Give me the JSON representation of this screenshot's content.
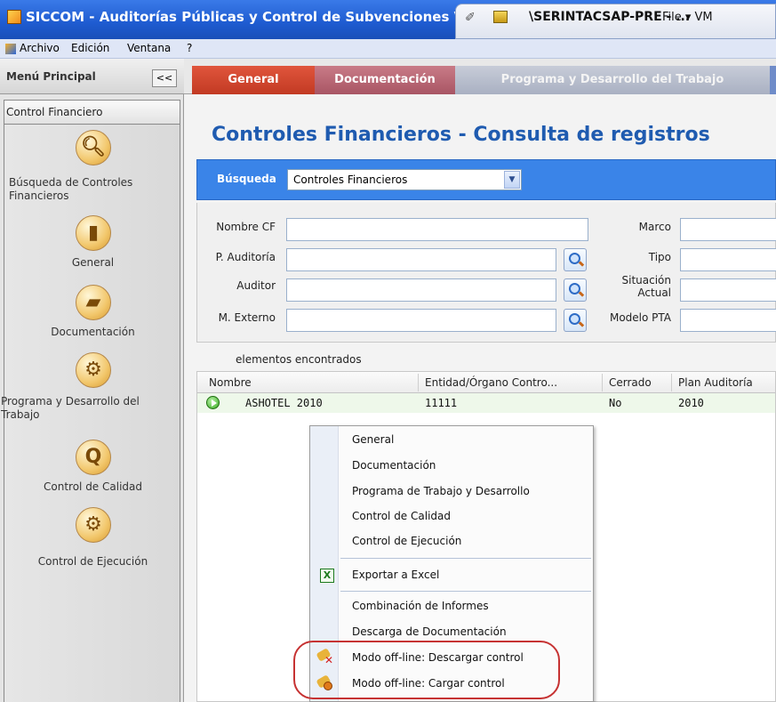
{
  "window": {
    "title": "SICCOM - Auditorías Públicas y Control de Subvenciones Ve",
    "remote_host": "\\SERINTACSAP-PRE - ...",
    "file_menu": "File ▾ VM"
  },
  "menubar": {
    "items": [
      "Archivo",
      "Edición",
      "Ventana",
      "?"
    ]
  },
  "sidebar": {
    "header": "Menú Principal",
    "collapse_label": "<<",
    "section": "Control Financiero",
    "items": [
      {
        "label": "Búsqueda de Controles Financieros",
        "icon": "magnifier-icon"
      },
      {
        "label": "General",
        "icon": "chart-icon"
      },
      {
        "label": "Documentación",
        "icon": "folder-icon"
      },
      {
        "label": "Programa y Desarrollo del Trabajo",
        "icon": "gears-icon"
      },
      {
        "label": "Control de Calidad",
        "icon": "quality-q-icon"
      },
      {
        "label": "Control de Ejecución",
        "icon": "gears-icon"
      }
    ]
  },
  "tabs": {
    "general": "General",
    "documentacion": "Documentación",
    "programa": "Programa y Desarrollo del Trabajo"
  },
  "main": {
    "title": "Controles Financieros - Consulta de registros",
    "search": {
      "label": "Búsqueda",
      "selected": "Controles Financieros"
    },
    "form": {
      "nombre_cf": "Nombre CF",
      "p_auditoria": "P. Auditoría",
      "auditor": "Auditor",
      "m_externo": "M. Externo",
      "marco": "Marco",
      "tipo": "Tipo",
      "situacion_1": "Situación",
      "situacion_2": "Actual",
      "modelo_pta": "Modelo PTA"
    },
    "found_label": "elementos encontrados",
    "grid": {
      "columns": [
        "Nombre",
        "Entidad/Órgano Contro...",
        "Cerrado",
        "Plan Auditoría"
      ],
      "rows": [
        {
          "nombre": "ASHOTEL 2010",
          "entidad": "11111",
          "cerrado": "No",
          "plan": "2010"
        }
      ]
    }
  },
  "context_menu": {
    "items": [
      "General",
      "Documentación",
      "Programa de Trabajo y Desarrollo",
      "Control de Calidad",
      "Control de Ejecución",
      "Exportar a Excel",
      "Combinación de Informes",
      "Descarga de Documentación",
      "Modo off-line: Descargar control",
      "Modo off-line: Cargar control"
    ],
    "excel_icon_glyph": "X"
  },
  "colors": {
    "title_bar": "#1e5bd0",
    "tab_general": "#c23a23",
    "tab_documentacion": "#a85564",
    "page_title": "#1f5bb0",
    "search_bar": "#3a84e8",
    "highlight": "#c63232"
  }
}
